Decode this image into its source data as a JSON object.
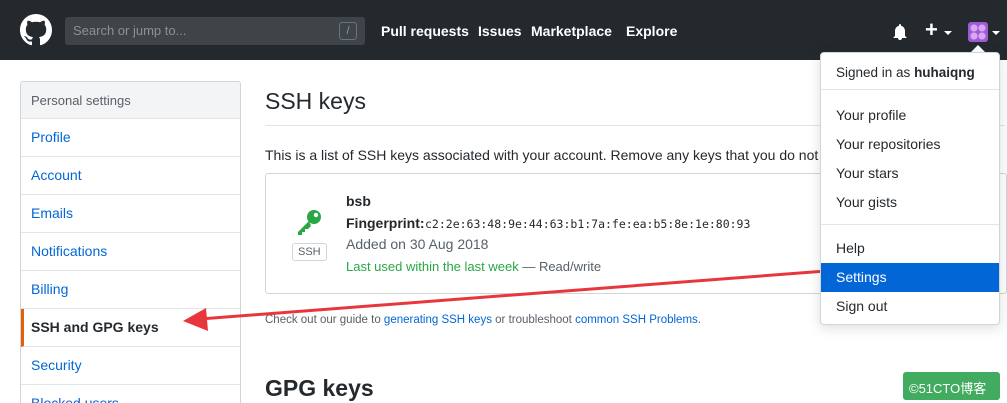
{
  "header": {
    "search_placeholder": "Search or jump to...",
    "search_key": "/",
    "nav": [
      "Pull requests",
      "Issues",
      "Marketplace",
      "Explore"
    ],
    "plus_label": "+"
  },
  "sidebar": {
    "heading": "Personal settings",
    "items": [
      {
        "label": "Profile"
      },
      {
        "label": "Account"
      },
      {
        "label": "Emails"
      },
      {
        "label": "Notifications"
      },
      {
        "label": "Billing"
      },
      {
        "label": "SSH and GPG keys",
        "selected": true
      },
      {
        "label": "Security"
      },
      {
        "label": "Blocked users"
      }
    ]
  },
  "main": {
    "ssh_title": "SSH keys",
    "ssh_description": "This is a list of SSH keys associated with your account. Remove any keys that you do not re",
    "key": {
      "name": "bsb",
      "badge": "SSH",
      "fingerprint_label": "Fingerprint:",
      "fingerprint": "c2:2e:63:48:9e:44:63:b1:7a:fe:ea:b5:8e:1e:80:93",
      "added": "Added on 30 Aug 2018",
      "last_used": "Last used within the last week",
      "access": " — Read/write"
    },
    "guide": {
      "prefix": "Check out our guide to ",
      "link1": "generating SSH keys",
      "middle": " or troubleshoot ",
      "link2": "common SSH Problems",
      "suffix": "."
    },
    "gpg_title": "GPG keys"
  },
  "dropdown": {
    "signed_in_prefix": "Signed in as ",
    "username": "huhaiqng",
    "items": [
      "Your profile",
      "Your repositories",
      "Your stars",
      "Your gists",
      "Help",
      "Settings",
      "Sign out"
    ],
    "active": "Settings"
  },
  "watermark": "©51CTO博客",
  "colors": {
    "header_bg": "#24292e",
    "link": "#0366d6",
    "selected_border": "#e36209",
    "key_icon": "#28a745",
    "menu_active": "#0366d6",
    "annotation_arrow": "#e8373c"
  }
}
